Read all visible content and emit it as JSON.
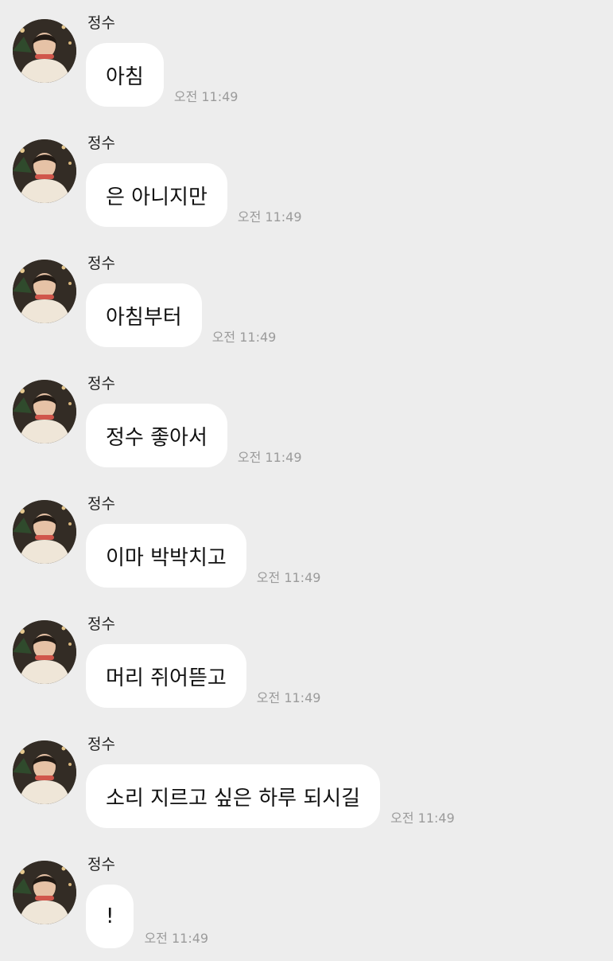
{
  "conversation": {
    "messages": [
      {
        "sender": "정수",
        "text": "아침",
        "time": "오전 11:49",
        "avatar_icon": "profile-photo"
      },
      {
        "sender": "정수",
        "text": "은 아니지만",
        "time": "오전 11:49",
        "avatar_icon": "profile-photo"
      },
      {
        "sender": "정수",
        "text": "아침부터",
        "time": "오전 11:49",
        "avatar_icon": "profile-photo"
      },
      {
        "sender": "정수",
        "text": "정수 좋아서",
        "time": "오전 11:49",
        "avatar_icon": "profile-photo"
      },
      {
        "sender": "정수",
        "text": "이마 박박치고",
        "time": "오전 11:49",
        "avatar_icon": "profile-photo"
      },
      {
        "sender": "정수",
        "text": "머리 쥐어뜯고",
        "time": "오전 11:49",
        "avatar_icon": "profile-photo"
      },
      {
        "sender": "정수",
        "text": "소리 지르고 싶은 하루 되시길",
        "time": "오전 11:49",
        "avatar_icon": "profile-photo"
      },
      {
        "sender": "정수",
        "text": "!",
        "time": "오전 11:49",
        "avatar_icon": "profile-photo"
      }
    ]
  },
  "colors": {
    "background": "#ededed",
    "bubble": "#ffffff",
    "timestamp": "#9b9b9b"
  }
}
